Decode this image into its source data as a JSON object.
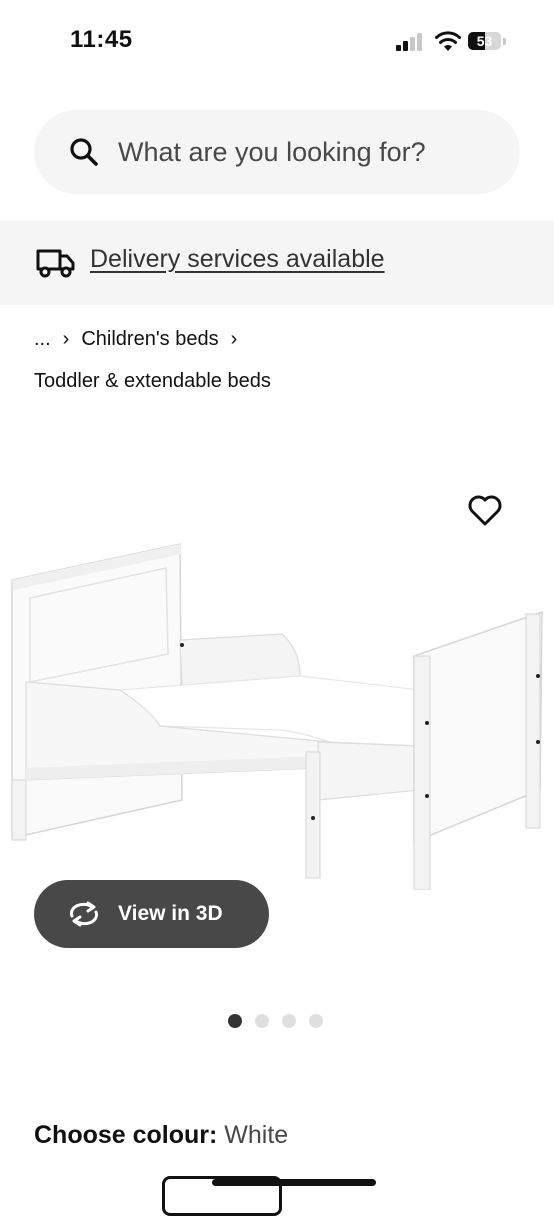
{
  "status_bar": {
    "time": "11:45",
    "battery_level": "53",
    "battery_fraction": 0.53
  },
  "search": {
    "placeholder": "What are you looking for?",
    "icon": "search-icon"
  },
  "delivery": {
    "label": "Delivery services available",
    "icon": "truck-icon"
  },
  "breadcrumb": {
    "ellipsis": "...",
    "items": [
      "Children's beds",
      "Toddler & extendable beds"
    ],
    "separator": "›"
  },
  "product": {
    "image_subject": "extendable white bed frame",
    "wishlist_icon": "heart-outline-icon"
  },
  "view3d": {
    "label": "View in 3D",
    "icon": "rotate-3d-icon"
  },
  "carousel": {
    "count": 4,
    "active_index": 0,
    "active_color": "#333333",
    "inactive_color": "#dfdfdf"
  },
  "colour": {
    "label": "Choose colour:",
    "value": "White"
  },
  "colors": {
    "text": "#111111",
    "button_bg": "#484848",
    "bar_bg": "#f5f5f5"
  }
}
